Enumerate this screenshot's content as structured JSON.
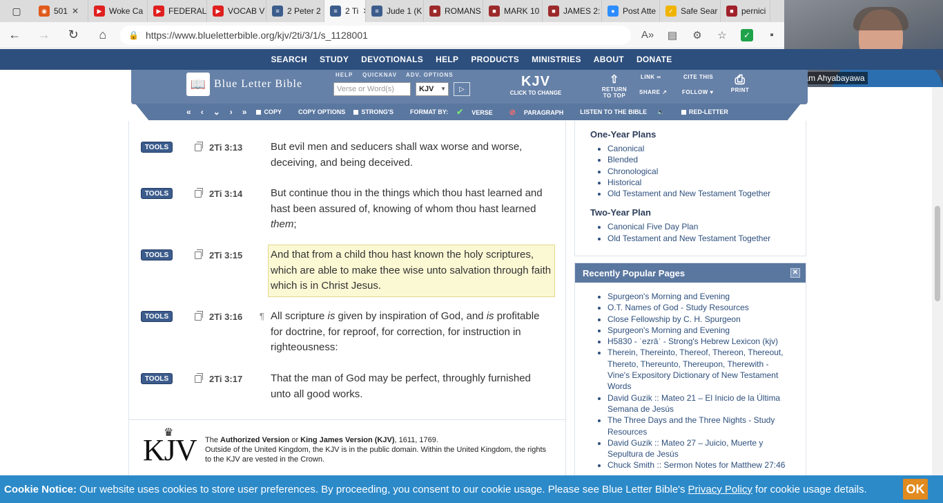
{
  "browser": {
    "tabs": [
      {
        "label": "501",
        "color": "#e05a1a",
        "glyph": "◉"
      },
      {
        "label": "Woke Ca",
        "color": "#e02020",
        "glyph": "▶"
      },
      {
        "label": "FEDERAL",
        "color": "#e02020",
        "glyph": "▶"
      },
      {
        "label": "VOCAB V",
        "color": "#e02020",
        "glyph": "▶"
      },
      {
        "label": "2 Peter 2",
        "color": "#3c5c8c",
        "glyph": "≡"
      },
      {
        "label": "2 Ti",
        "color": "#3c5c8c",
        "glyph": "≡",
        "active": true
      },
      {
        "label": "Jude 1 (K",
        "color": "#3c5c8c",
        "glyph": "≡"
      },
      {
        "label": "ROMANS",
        "color": "#9c2a2a",
        "glyph": "■"
      },
      {
        "label": "MARK 10",
        "color": "#9c2a2a",
        "glyph": "■"
      },
      {
        "label": "JAMES 2:",
        "color": "#9c2a2a",
        "glyph": "■"
      },
      {
        "label": "Post Atte",
        "color": "#2d8cff",
        "glyph": "●"
      },
      {
        "label": "Safe Sear",
        "color": "#f0b400",
        "glyph": "✓"
      },
      {
        "label": "pernici",
        "color": "#a0202a",
        "glyph": "■"
      }
    ],
    "url": "https://www.blueletterbible.org/kjv/2ti/3/1/s_1128001"
  },
  "video": {
    "name": "Yawam Ahyabayawa"
  },
  "sitenav": [
    "SEARCH",
    "STUDY",
    "DEVOTIONALS",
    "HELP",
    "PRODUCTS",
    "MINISTRIES",
    "ABOUT",
    "DONATE"
  ],
  "toolbar": {
    "logo": "Blue Letter Bible",
    "help_label": "HELP",
    "quicknav_label": "QUICKNAV",
    "adv_label": "ADV. OPTIONS",
    "search_placeholder": "Verse or Word(s)",
    "version": "KJV",
    "kjv_big": "KJV",
    "kjv_small": "CLICK TO CHANGE",
    "return_top": "RETURN TO TOP",
    "link": "LINK",
    "share": "SHARE",
    "cite": "CITE THIS",
    "follow": "FOLLOW",
    "print": "PRINT"
  },
  "subtoolbar": {
    "copy": "COPY",
    "copy_options": "COPY OPTIONS",
    "strongs": "STRONG'S",
    "format_by": "FORMAT BY:",
    "verse": "VERSE",
    "paragraph": "PARAGRAPH",
    "listen": "LISTEN TO THE BIBLE",
    "red_letter": "RED-LETTER"
  },
  "verses": [
    {
      "tools": "TOOLS",
      "ref": "2Ti 3:13",
      "pilcrow": false,
      "html": "But evil men and seducers shall wax worse and worse, deceiving, and being deceived."
    },
    {
      "tools": "TOOLS",
      "ref": "2Ti 3:14",
      "pilcrow": false,
      "html": "But continue thou in the things which thou hast learned and hast been assured of, knowing of whom thou hast learned <i>them</i>;"
    },
    {
      "tools": "TOOLS",
      "ref": "2Ti 3:15",
      "pilcrow": false,
      "html": "And that from a child thou hast known the holy scriptures, which are able to make thee wise unto salvation through faith which is in Christ Jesus."
    },
    {
      "tools": "TOOLS",
      "ref": "2Ti 3:16",
      "pilcrow": true,
      "html": "All scripture <i>is</i> given by inspiration of God, and <i>is</i> profitable for doctrine, for reproof, for correction, for instruction in righteousness:"
    },
    {
      "tools": "TOOLS",
      "ref": "2Ti 3:17",
      "pilcrow": false,
      "html": "That the man of God may be perfect, throughly furnished unto all good works."
    }
  ],
  "kjv_footer": {
    "logo": "KJV",
    "line1_pre": "The ",
    "line1_b1": "Authorized Version",
    "line1_mid": " or ",
    "line1_b2": "King James Version (KJV)",
    "line1_post": ", 1611, 1769.",
    "line2": "Outside of the United Kingdom, the KJV is in the public domain. Within the United Kingdom, the rights to the KJV are vested in the Crown."
  },
  "sidebar": {
    "one_year_title": "One-Year Plans",
    "one_year_items": [
      "Canonical",
      "Blended",
      "Chronological",
      "Historical",
      "Old Testament and New Testament Together"
    ],
    "two_year_title": "Two-Year Plan",
    "two_year_items": [
      "Canonical Five Day Plan",
      "Old Testament and New Testament Together"
    ],
    "popular_title": "Recently Popular Pages",
    "popular_items": [
      "Spurgeon's Morning and Evening",
      "O.T. Names of God - Study Resources",
      "Close Fellowship by C. H. Spurgeon",
      "Spurgeon's Morning and Evening",
      "H5830 - ʿezrāʾ - Strong's Hebrew Lexicon (kjv)",
      "Therein, Thereinto, Thereof, Thereon, Thereout, Thereto, Thereunto, Thereupon, Therewith - Vine's Expository Dictionary of New Testament Words",
      "David Guzik :: Mateo 21 – El Inicio de la Última Semana de Jesús",
      "The Three Days and the Three Nights - Study Resources",
      "David Guzik :: Mateo 27 – Juicio, Muerte y Sepultura de Jesús",
      "Chuck Smith :: Sermon Notes for Matthew 27:46"
    ]
  },
  "cookie": {
    "label": "Cookie Notice:",
    "text1": "Our website uses cookies to store user preferences. By proceeding, you consent to our cookie usage. Please see Blue Letter Bible's",
    "link": "Privacy Policy",
    "text2": "for cookie usage details.",
    "ok": "OK"
  }
}
